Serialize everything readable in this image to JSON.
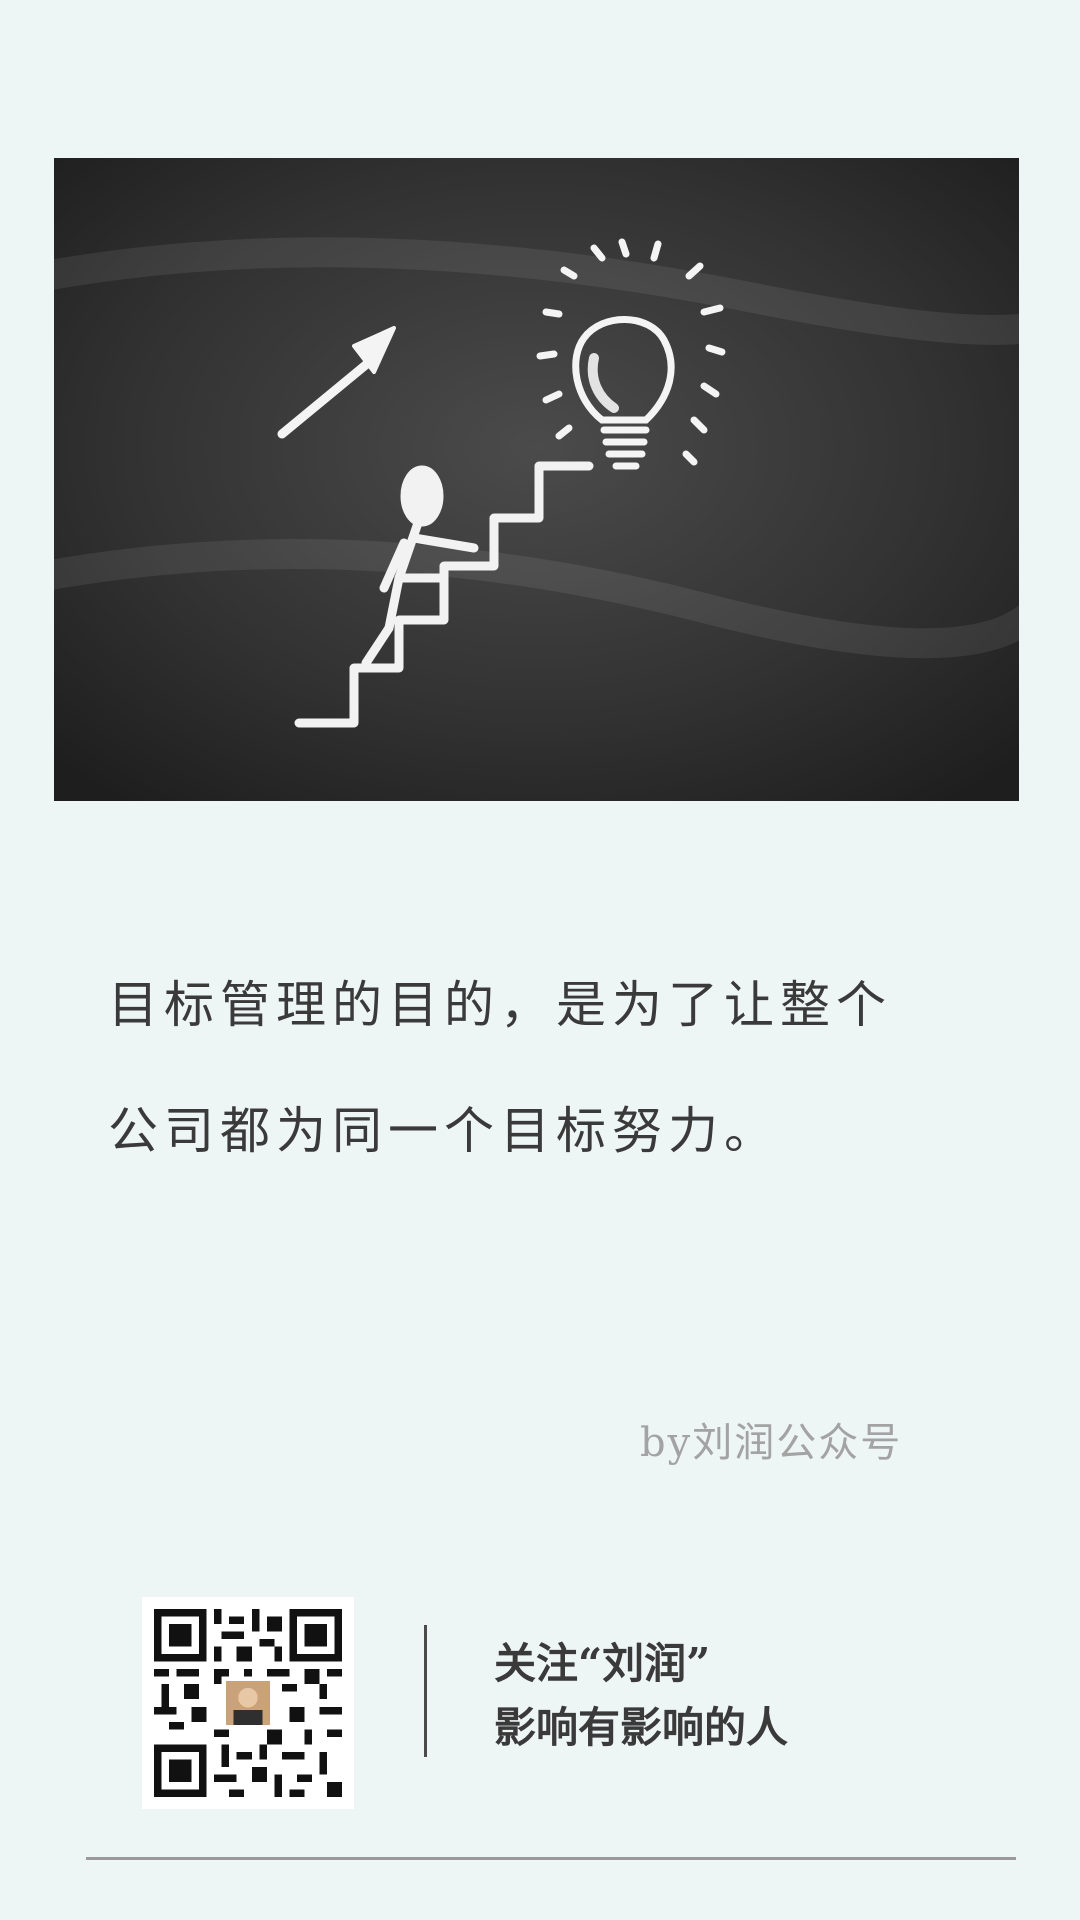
{
  "image": {
    "alt_icon": "chalkboard-stairs-lightbulb-image"
  },
  "quote": {
    "lines": [
      "目标管理的目的，是为了让整个",
      "公司都为同一个目标努力。"
    ]
  },
  "byline": "by刘润公众号",
  "promo": {
    "lines": [
      "关注“刘润”",
      "影响有影响的人"
    ]
  },
  "colors": {
    "background": "#eef5f5",
    "text": "#3a3a3a",
    "byline": "#a3a3a3"
  }
}
